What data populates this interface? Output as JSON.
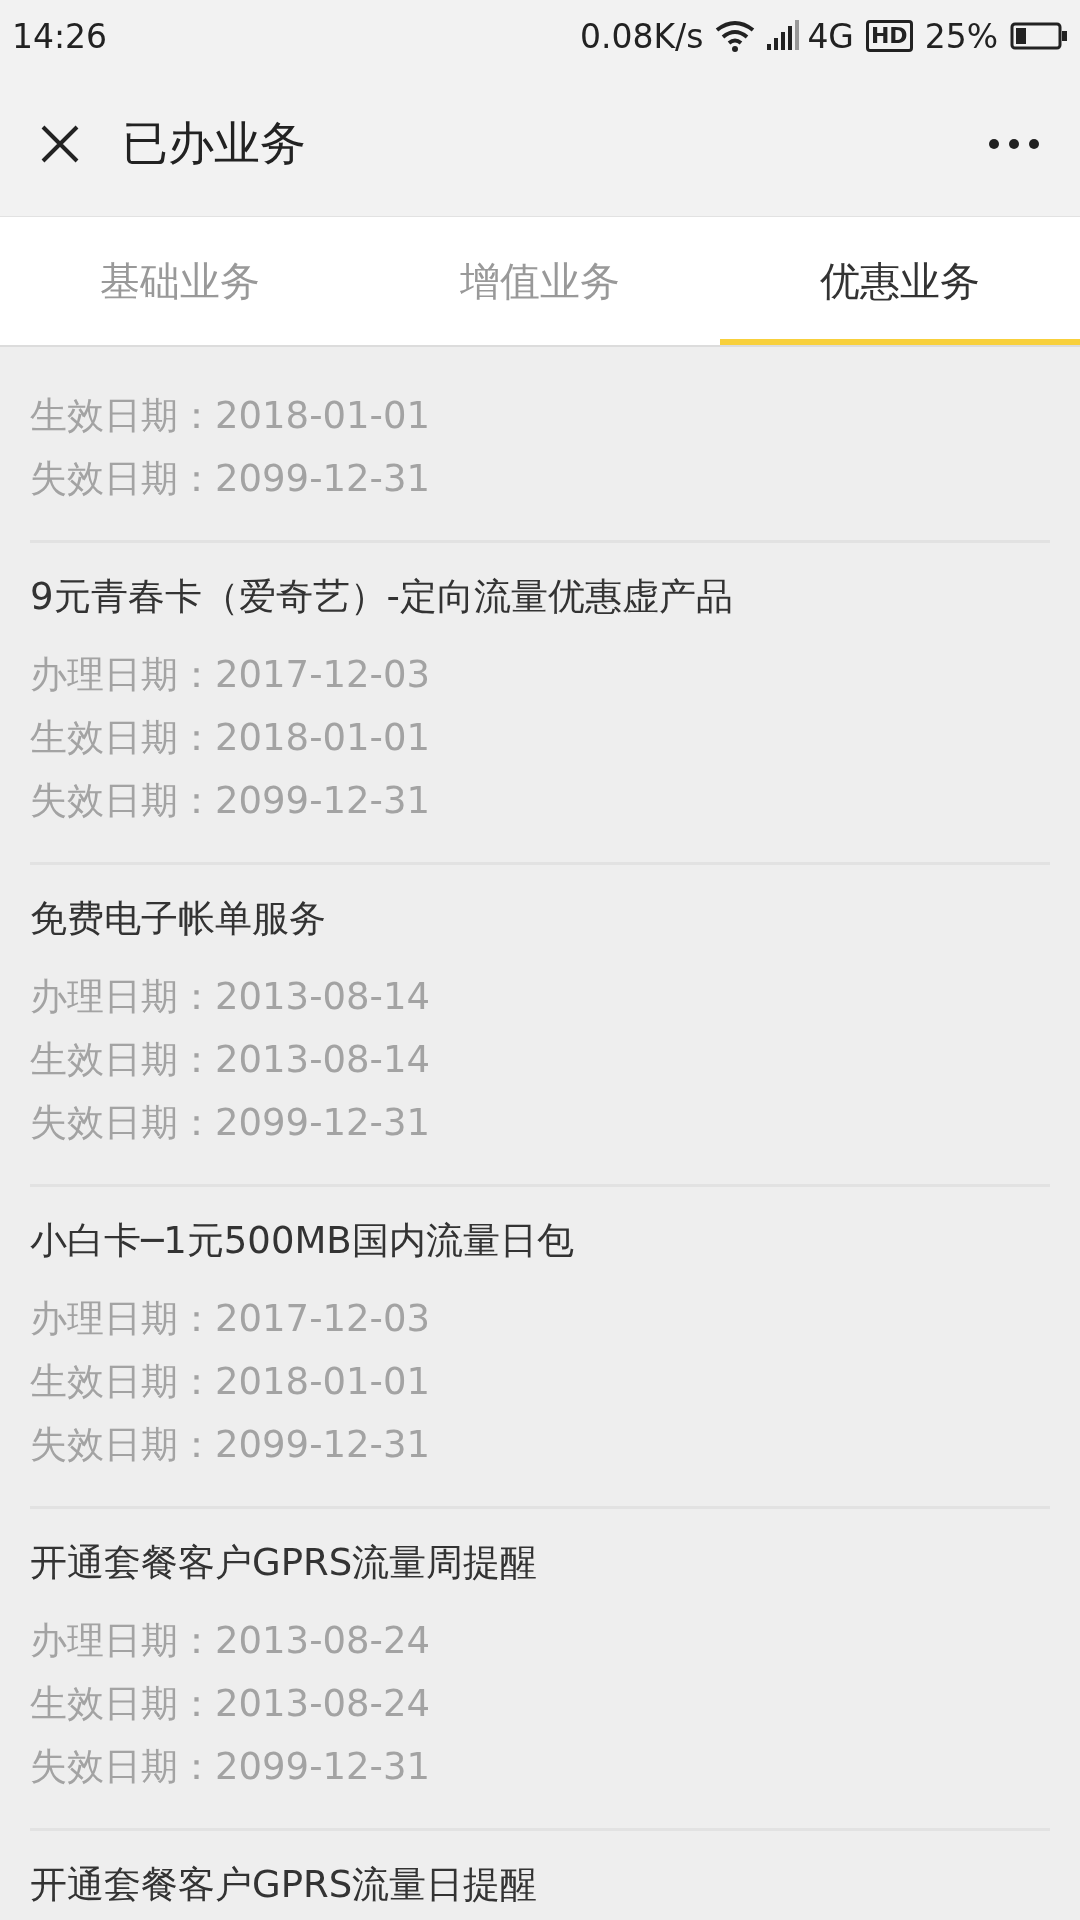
{
  "status_bar": {
    "time": "14:26",
    "speed": "0.08K/s",
    "network": "4G",
    "hd": "HD",
    "battery": "25%"
  },
  "header": {
    "title": "已办业务"
  },
  "tabs": [
    {
      "label": "基础业务",
      "selected": false
    },
    {
      "label": "增值业务",
      "selected": false
    },
    {
      "label": "优惠业务",
      "selected": true
    }
  ],
  "items": [
    {
      "dates": [
        "生效日期：2018-01-01",
        "失效日期：2099-12-31"
      ]
    },
    {
      "name": "9元青春卡（爱奇艺）-定向流量优惠虚产品",
      "dates": [
        "办理日期：2017-12-03",
        "生效日期：2018-01-01",
        "失效日期：2099-12-31"
      ]
    },
    {
      "name": "免费电子帐单服务",
      "dates": [
        "办理日期：2013-08-14",
        "生效日期：2013-08-14",
        "失效日期：2099-12-31"
      ]
    },
    {
      "name": "小白卡─1元500MB国内流量日包",
      "dates": [
        "办理日期：2017-12-03",
        "生效日期：2018-01-01",
        "失效日期：2099-12-31"
      ]
    },
    {
      "name": "开通套餐客户GPRS流量周提醒",
      "dates": [
        "办理日期：2013-08-24",
        "生效日期：2013-08-24",
        "失效日期：2099-12-31"
      ]
    },
    {
      "name": "开通套餐客户GPRS流量日提醒"
    }
  ]
}
